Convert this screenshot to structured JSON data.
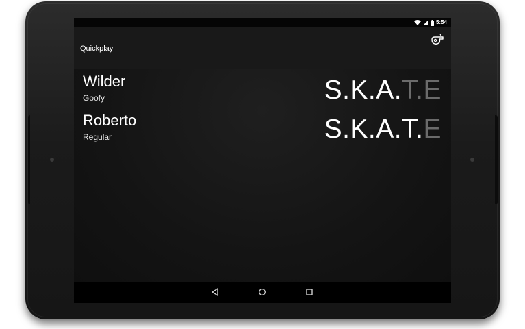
{
  "status_bar": {
    "time": "5:54",
    "icons": [
      "wifi-icon",
      "signal-icon",
      "battery-icon"
    ]
  },
  "action_bar": {
    "title": "Quickplay",
    "action_icon": "whistle-icon"
  },
  "players": [
    {
      "name": "Wilder",
      "stance": "Goofy",
      "letters": [
        {
          "text": "S.",
          "earned": true
        },
        {
          "text": "K.",
          "earned": true
        },
        {
          "text": "A.",
          "earned": true
        },
        {
          "text": "T.",
          "earned": false
        },
        {
          "text": "E",
          "earned": false
        }
      ]
    },
    {
      "name": "Roberto",
      "stance": "Regular",
      "letters": [
        {
          "text": "S.",
          "earned": true
        },
        {
          "text": "K.",
          "earned": true
        },
        {
          "text": "A.",
          "earned": true
        },
        {
          "text": "T.",
          "earned": true
        },
        {
          "text": "E",
          "earned": false
        }
      ]
    }
  ],
  "nav_bar": {
    "buttons": [
      "back-icon",
      "home-icon",
      "recents-icon"
    ]
  },
  "colors": {
    "letter_earned": "#ffffff",
    "letter_pending": "#6b6b6b",
    "action_bar": "#191919"
  }
}
